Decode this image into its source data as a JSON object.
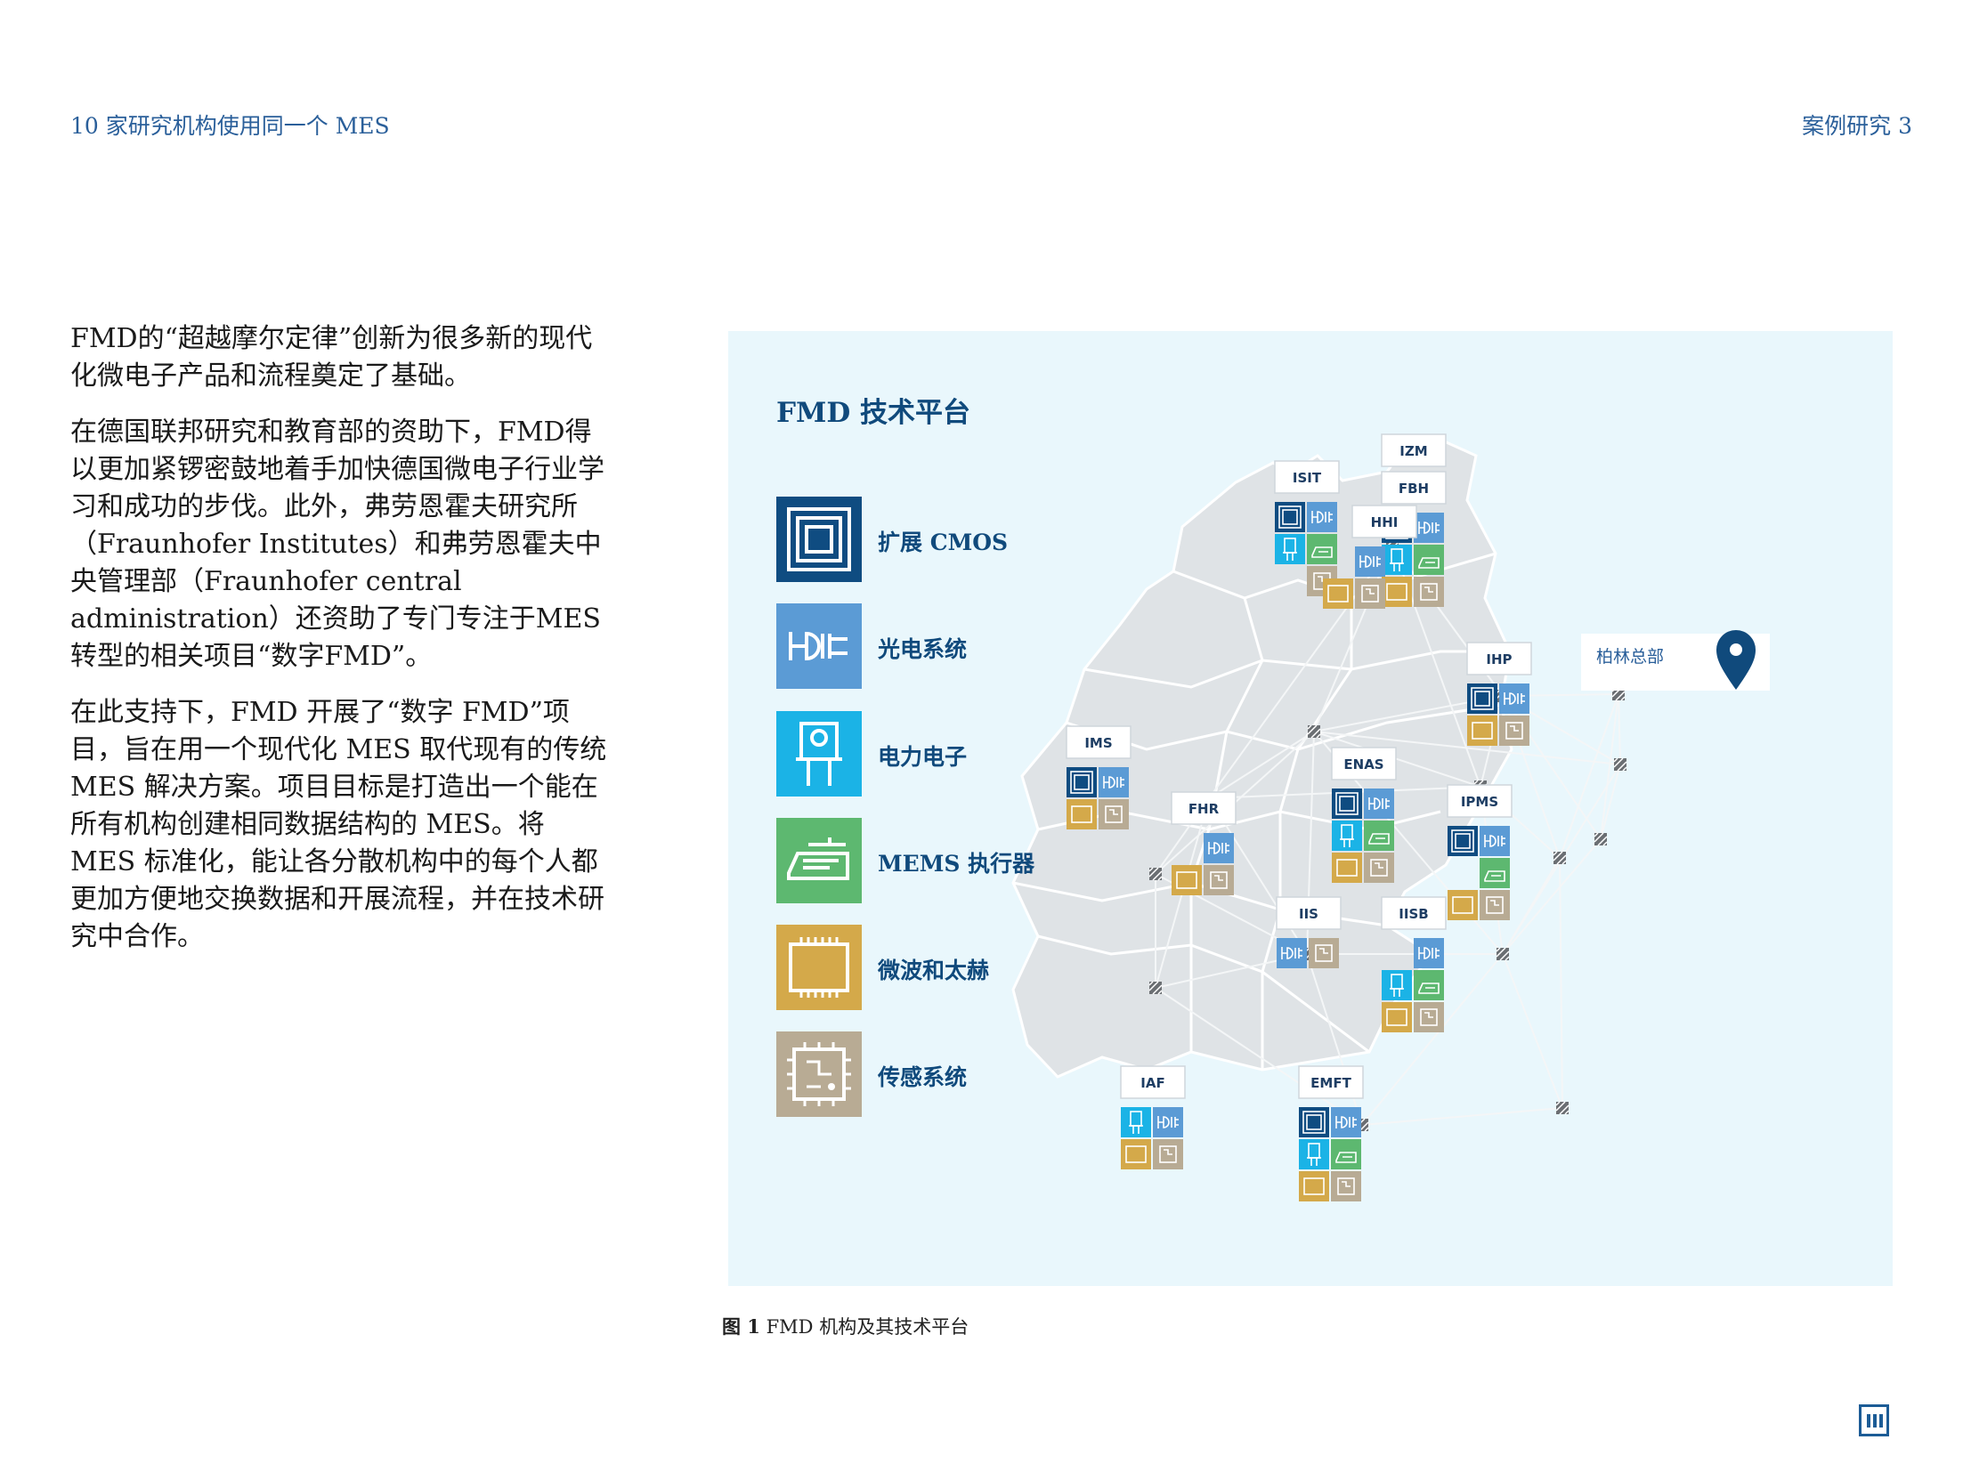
{
  "header": {
    "left": "10 家研究机构使用同一个 MES",
    "right": "案例研究  3"
  },
  "body": {
    "paragraphs": [
      "FMD的“超越摩尔定律”创新为很多新的现代化微电子产品和流程奠定了基础。",
      "在德国联邦研究和教育部的资助下，FMD得以更加紧锣密鼓地着手加快德国微电子行业学习和成功的步伐。此外，弗劳恩霍夫研究所（Fraunhofer Institutes）和弗劳恩霍夫中央管理部（Fraunhofer central administration）还资助了专门专注于MES转型的相关项目“数字FMD”。",
      "在此支持下，FMD 开展了“数字 FMD”项目，旨在用一个现代化 MES 取代现有的传统 MES 解决方案。项目目标是打造出一个能在所有机构创建相同数据结构的 MES。将 MES 标准化，能让各分散机构中的每个人都更加方便地交换数据和开展流程，并在技术研究中合作。"
    ]
  },
  "figure": {
    "title": "FMD 技术平台",
    "legend": [
      {
        "key": "cmos",
        "label": "扩展 CMOS",
        "color": "#0f4c81",
        "icon": "chip-outline-icon"
      },
      {
        "key": "opto",
        "label": "光电系统",
        "color": "#5b9bd5",
        "icon": "optoelectronic-icon"
      },
      {
        "key": "power",
        "label": "电力电子",
        "color": "#1bb3e6",
        "icon": "transistor-icon"
      },
      {
        "key": "mems",
        "label": "MEMS 执行器",
        "color": "#5db870",
        "icon": "mems-actuator-icon"
      },
      {
        "key": "micro",
        "label": "微波和太赫",
        "color": "#d4a94a",
        "icon": "microwave-chip-icon"
      },
      {
        "key": "sens",
        "label": "传感系统",
        "color": "#b8ab94",
        "icon": "sensor-circuit-icon"
      }
    ],
    "hq_label": "柏林总部",
    "institutes": [
      {
        "name": "IZM"
      },
      {
        "name": "FBH"
      },
      {
        "name": "ISIT"
      },
      {
        "name": "HHI"
      },
      {
        "name": "IHP"
      },
      {
        "name": "IMS"
      },
      {
        "name": "FHR"
      },
      {
        "name": "ENAS"
      },
      {
        "name": "IPMS"
      },
      {
        "name": "IIS"
      },
      {
        "name": "IISB"
      },
      {
        "name": "IAF"
      },
      {
        "name": "EMFT"
      }
    ],
    "caption_prefix": "图 1",
    "caption_text": " FMD 机构及其技术平台"
  }
}
